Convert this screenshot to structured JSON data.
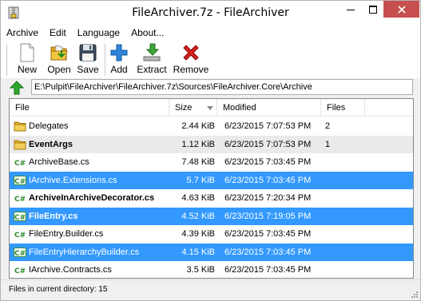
{
  "window": {
    "title": "FileArchiver.7z - FileArchiver"
  },
  "menu": [
    "Archive",
    "Edit",
    "Language",
    "About..."
  ],
  "toolbar": {
    "new_label": "New",
    "open_label": "Open",
    "save_label": "Save",
    "add_label": "Add",
    "extract_label": "Extract",
    "remove_label": "Remove"
  },
  "address": {
    "path": "E:\\Pulpit\\FileArchiver\\FileArchiver.7z\\Sources\\FileArchiver.Core\\Archive"
  },
  "list": {
    "columns": {
      "file": "File",
      "size": "Size",
      "modified": "Modified",
      "files": "Files"
    },
    "rows": [
      {
        "name": "Delegates",
        "size": "2.44 KiB",
        "modified": "6/23/2015 7:07:53 PM",
        "files": "2",
        "icon": "folder-icon",
        "state": "normal",
        "bold": false
      },
      {
        "name": "EventArgs",
        "size": "1.12 KiB",
        "modified": "6/23/2015 7:07:53 PM",
        "files": "1",
        "icon": "folder-icon",
        "state": "hover",
        "bold": true
      },
      {
        "name": "ArchiveBase.cs",
        "size": "7.48 KiB",
        "modified": "6/23/2015 7:03:45 PM",
        "files": "",
        "icon": "csharp-file-icon",
        "state": "normal",
        "bold": false
      },
      {
        "name": "IArchive.Extensions.cs",
        "size": "5.7 KiB",
        "modified": "6/23/2015 7:03:45 PM",
        "files": "",
        "icon": "csharp-file-icon",
        "state": "selected",
        "bold": false
      },
      {
        "name": "ArchiveInArchiveDecorator.cs",
        "size": "4.63 KiB",
        "modified": "6/23/2015 7:20:34 PM",
        "files": "",
        "icon": "csharp-file-icon",
        "state": "normal",
        "bold": true
      },
      {
        "name": "FileEntry.cs",
        "size": "4.52 KiB",
        "modified": "6/23/2015 7:19:05 PM",
        "files": "",
        "icon": "csharp-file-icon",
        "state": "selected",
        "bold": true
      },
      {
        "name": "FileEntry.Builder.cs",
        "size": "4.39 KiB",
        "modified": "6/23/2015 7:03:45 PM",
        "files": "",
        "icon": "csharp-file-icon",
        "state": "normal",
        "bold": false
      },
      {
        "name": "FileEntryHierarchyBuilder.cs",
        "size": "4.15 KiB",
        "modified": "6/23/2015 7:03:45 PM",
        "files": "",
        "icon": "csharp-file-icon",
        "state": "selected",
        "bold": false
      },
      {
        "name": "IArchive.Contracts.cs",
        "size": "3.5 KiB",
        "modified": "6/23/2015 7:03:45 PM",
        "files": "",
        "icon": "csharp-file-icon",
        "state": "normal",
        "bold": false
      }
    ]
  },
  "status": {
    "text": "Files in current directory: 15"
  },
  "colors": {
    "selection": "#3399ff",
    "close_button": "#c7504f",
    "hover_row": "#eaeaea"
  }
}
